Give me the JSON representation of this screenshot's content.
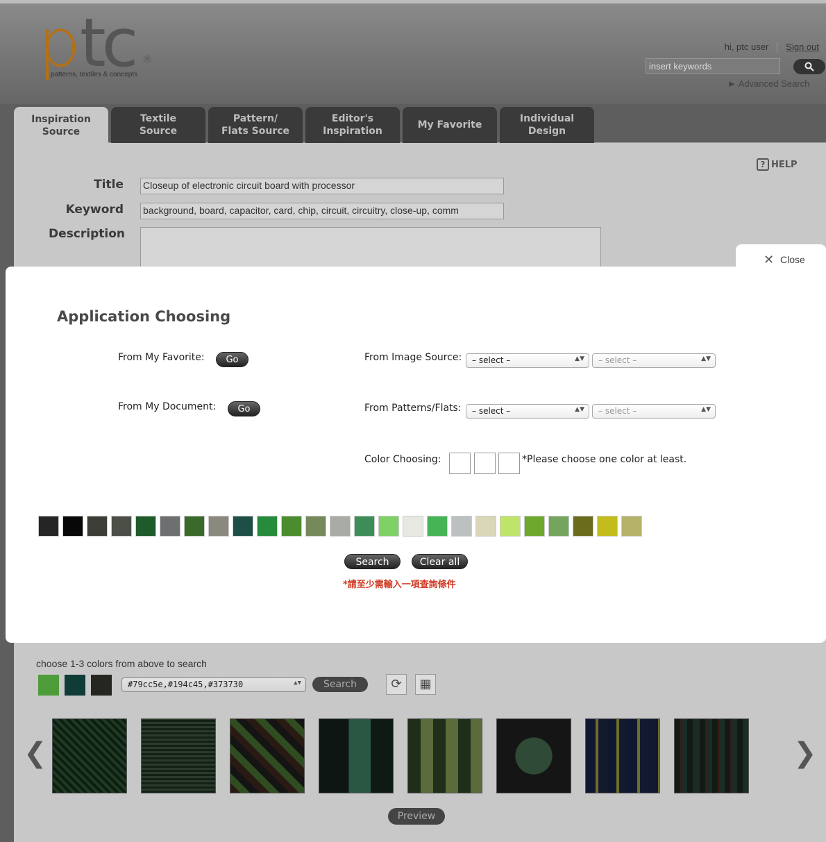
{
  "logo": {
    "letters_p": "p",
    "letters_tc": "tc",
    "registered": "®",
    "tagline": "patterns, textiles & concepts"
  },
  "header": {
    "greeting": "hi, ptc user",
    "sign_out": "Sign out",
    "search_placeholder": "insert keywords",
    "search_icon": "search-icon",
    "advanced_search": "► Advanced Search"
  },
  "tabs": [
    {
      "label": "Inspiration\nSource",
      "active": true
    },
    {
      "label": "Textile\nSource"
    },
    {
      "label": "Pattern/\nFlats Source"
    },
    {
      "label": "Editor's\nInspiration"
    },
    {
      "label": "My Favorite"
    },
    {
      "label": "Individual\nDesign"
    }
  ],
  "help": {
    "icon": "?",
    "label": "HELP"
  },
  "form": {
    "title_label": "Title",
    "title_value": "Closeup of electronic circuit board with processor",
    "keyword_label": "Keyword",
    "keyword_value": "background, board, capacitor, card, chip, circuit, circuitry, close-up, comm",
    "description_label": "Description"
  },
  "modal": {
    "close_icon": "✕",
    "close_label": "Close",
    "title": "Application Choosing",
    "from_favorite": "From My Favorite:",
    "from_document": "From My Document:",
    "go_label": "Go",
    "from_image": "From Image Source:",
    "from_patterns": "From Patterns/Flats:",
    "select_primary": "– select –",
    "select_secondary": "– select –",
    "color_choosing": "Color Choosing:",
    "color_note": "*Please choose one color at least.",
    "swatches": [
      "#252525",
      "#080808",
      "#3d3d38",
      "#4b4f47",
      "#1f5a2a",
      "#6e6f70",
      "#3a6a29",
      "#8a887f",
      "#1e4f47",
      "#268b3a",
      "#4a8c2e",
      "#75895a",
      "#a9aca4",
      "#3e8c58",
      "#7fd065",
      "#e8e8e2",
      "#46b356",
      "#bcc0c0",
      "#d9d7b7",
      "#bee56a",
      "#6ea82c",
      "#74a55c",
      "#6b6c1c",
      "#c2bd1c",
      "#b5b26a"
    ],
    "search_label": "Search",
    "clear_label": "Clear all",
    "warning": "*請至少需輸入一項查詢條件"
  },
  "bottom": {
    "instruction": "choose 1-3 colors from above to search",
    "chosen_colors": [
      "#4f9c3a",
      "#0f3c36",
      "#252620"
    ],
    "color_value": "#79cc5e,#194c45,#373730",
    "search_label": "Search",
    "refresh_icon": "refresh-icon",
    "grid_icon": "grid-icon",
    "prev_arrow": "❮",
    "next_arrow": "❯",
    "preview_label": "Preview"
  }
}
